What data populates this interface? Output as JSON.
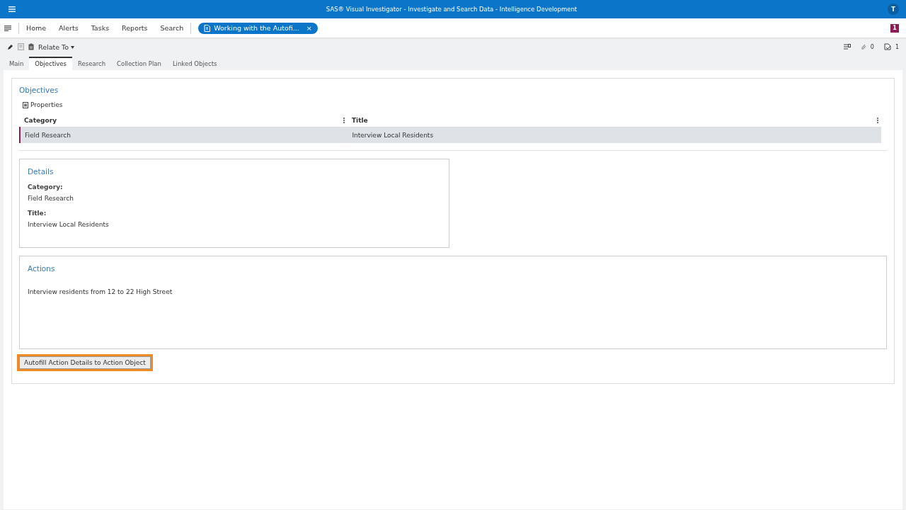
{
  "title_bar": {
    "title": "SAS® Visual Investigator - Investigate and Search Data - Intelligence Development",
    "avatar": "T"
  },
  "nav": {
    "items": [
      {
        "label": "Home"
      },
      {
        "label": "Alerts"
      },
      {
        "label": "Tasks"
      },
      {
        "label": "Reports"
      },
      {
        "label": "Search"
      }
    ],
    "open_tab": {
      "label": "Working with the Autofi...",
      "close": "×"
    },
    "notification_count": "1"
  },
  "toolbar": {
    "relate_to": "Relate To",
    "attachments_count": "0",
    "tasks_count": "1"
  },
  "tabs": [
    {
      "label": "Main",
      "selected": false
    },
    {
      "label": "Objectives",
      "selected": true
    },
    {
      "label": "Research",
      "selected": false
    },
    {
      "label": "Collection Plan",
      "selected": false
    },
    {
      "label": "Linked Objects",
      "selected": false
    }
  ],
  "objectives": {
    "heading": "Objectives",
    "properties": "Properties",
    "table": {
      "columns": [
        "Category",
        "Title"
      ],
      "rows": [
        {
          "cells": [
            "Field Research",
            "Interview Local Residents"
          ],
          "selected": true
        }
      ]
    }
  },
  "details": {
    "heading": "Details",
    "fields": [
      {
        "label": "Category:",
        "value": "Field Research"
      },
      {
        "label": "Title:",
        "value": "Interview Local Residents"
      }
    ]
  },
  "actions": {
    "heading": "Actions",
    "text": "Interview residents from 12 to 22 High Street"
  },
  "autofill_button": {
    "label": "Autofill Action Details to Action Object",
    "focused": true
  }
}
